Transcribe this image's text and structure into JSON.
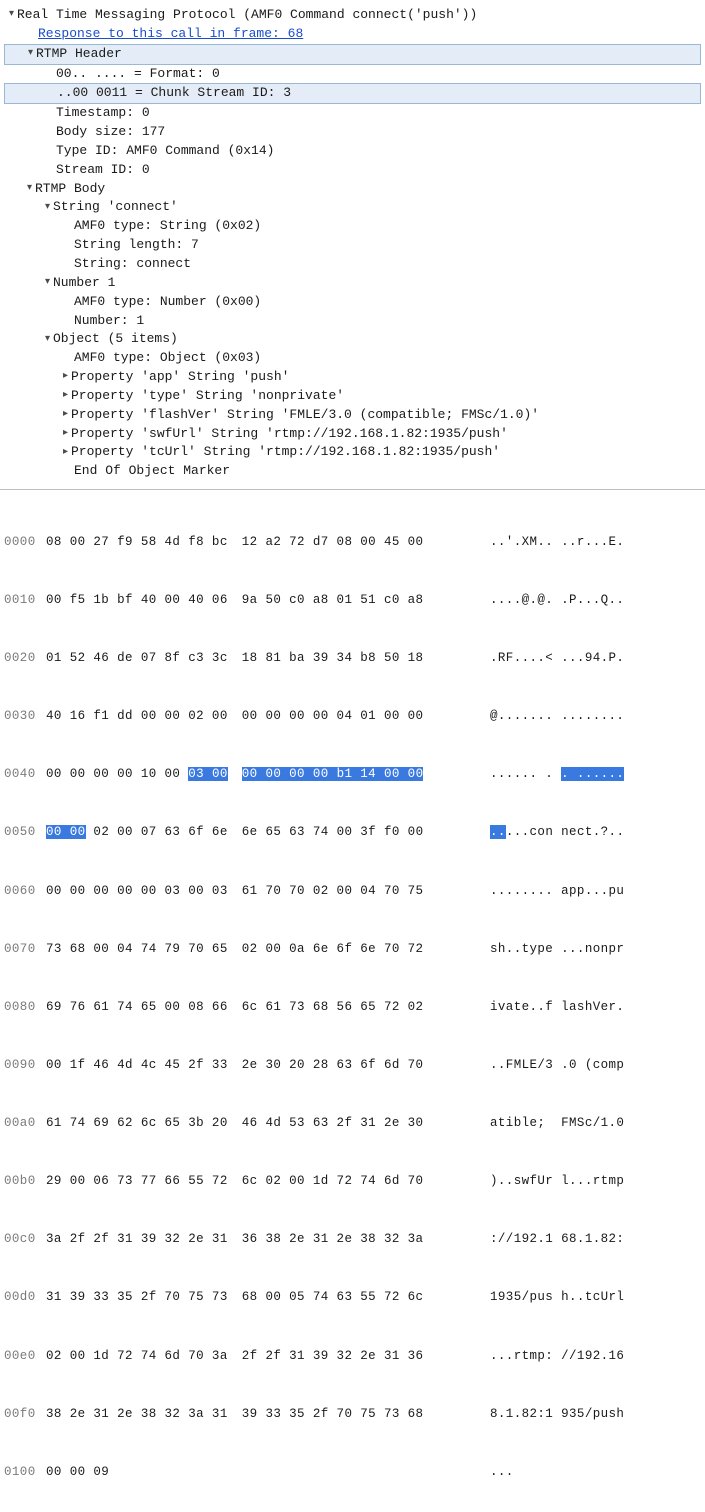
{
  "proto_title": "Real Time Messaging Protocol (AMF0 Command connect('push'))",
  "response_link": "Response to this call in frame: 68",
  "hdr_label": "RTMP Header",
  "hdr_format": "00.. .... = Format: 0",
  "hdr_csid": "..00 0011 = Chunk Stream ID: 3",
  "hdr_ts": "Timestamp: 0",
  "hdr_body": "Body size: 177",
  "hdr_type": "Type ID: AMF0 Command (0x14)",
  "hdr_sid": "Stream ID: 0",
  "body_label": "RTMP Body",
  "str_label": "String 'connect'",
  "str_amf": "AMF0 type: String (0x02)",
  "str_len": "String length: 7",
  "str_val": "String: connect",
  "num_label": "Number 1",
  "num_amf": "AMF0 type: Number (0x00)",
  "num_val": "Number: 1",
  "obj_label": "Object (5 items)",
  "obj_amf": "AMF0 type: Object (0x03)",
  "p_app": "Property 'app' String 'push'",
  "p_type": "Property 'type' String 'nonprivate'",
  "p_flash": "Property 'flashVer' String 'FMLE/3.0 (compatible; FMSc/1.0)'",
  "p_swf": "Property 'swfUrl' String 'rtmp://192.168.1.82:1935/push'",
  "p_tc": "Property 'tcUrl' String 'rtmp://192.168.1.82:1935/push'",
  "obj_end": "End Of Object Marker",
  "hex": {
    "0000": {
      "o": "0000",
      "b1": "08 00 27 f9 58 4d f8 bc",
      "b2": "12 a2 72 d7 08 00 45 00",
      "a1": "..'.XM..",
      "a2": "..r...E."
    },
    "0010": {
      "o": "0010",
      "b1": "00 f5 1b bf 40 00 40 06",
      "b2": "9a 50 c0 a8 01 51 c0 a8",
      "a1": "....@.@.",
      "a2": ".P...Q.."
    },
    "0020": {
      "o": "0020",
      "b1": "01 52 46 de 07 8f c3 3c",
      "b2": "18 81 ba 39 34 b8 50 18",
      "a1": ".RF....<",
      "a2": "...94.P."
    },
    "0030": {
      "o": "0030",
      "b1": "40 16 f1 dd 00 00 02 00",
      "b2": "00 00 00 00 04 01 00 00",
      "a1": "@.......",
      "a2": "........"
    },
    "0040": {
      "o": "0040",
      "b1a": "00 00 00 00 10 00 ",
      "b1sel": "03 00",
      "b2sel": "00 00 00 00 b1 14 00 00",
      "a1a": "...... .",
      "a2sel": ". ......"
    },
    "0050": {
      "o": "0050",
      "b1sel": "00 00",
      "b1b": " 02 00 07 63 6f 6e",
      "b2": "6e 65 63 74 00 3f f0 00",
      "a1sel": "..",
      "a1b": "...con",
      "a2": "nect.?.."
    },
    "0060": {
      "o": "0060",
      "b1": "00 00 00 00 00 03 00 03",
      "b2": "61 70 70 02 00 04 70 75",
      "a1": "........",
      "a2": "app...pu"
    },
    "0070": {
      "o": "0070",
      "b1": "73 68 00 04 74 79 70 65",
      "b2": "02 00 0a 6e 6f 6e 70 72",
      "a1": "sh..type",
      "a2": "...nonpr"
    },
    "0080": {
      "o": "0080",
      "b1": "69 76 61 74 65 00 08 66",
      "b2": "6c 61 73 68 56 65 72 02",
      "a1": "ivate..f",
      "a2": "lashVer."
    },
    "0090": {
      "o": "0090",
      "b1": "00 1f 46 4d 4c 45 2f 33",
      "b2": "2e 30 20 28 63 6f 6d 70",
      "a1": "..FMLE/3",
      "a2": ".0 (comp"
    },
    "00a0": {
      "o": "00a0",
      "b1": "61 74 69 62 6c 65 3b 20",
      "b2": "46 4d 53 63 2f 31 2e 30",
      "a1": "atible; ",
      "a2": "FMSc/1.0"
    },
    "00b0": {
      "o": "00b0",
      "b1": "29 00 06 73 77 66 55 72",
      "b2": "6c 02 00 1d 72 74 6d 70",
      "a1": ")..swfUr",
      "a2": "l...rtmp"
    },
    "00c0": {
      "o": "00c0",
      "b1": "3a 2f 2f 31 39 32 2e 31",
      "b2": "36 38 2e 31 2e 38 32 3a",
      "a1": "://192.1",
      "a2": "68.1.82:"
    },
    "00d0": {
      "o": "00d0",
      "b1": "31 39 33 35 2f 70 75 73",
      "b2": "68 00 05 74 63 55 72 6c",
      "a1": "1935/pus",
      "a2": "h..tcUrl"
    },
    "00e0": {
      "o": "00e0",
      "b1": "02 00 1d 72 74 6d 70 3a",
      "b2": "2f 2f 31 39 32 2e 31 36",
      "a1": "...rtmp:",
      "a2": "//192.16"
    },
    "00f0": {
      "o": "00f0",
      "b1": "38 2e 31 2e 38 32 3a 31",
      "b2": "39 33 35 2f 70 75 73 68",
      "a1": "8.1.82:1",
      "a2": "935/push"
    },
    "0100": {
      "o": "0100",
      "b1": "00 00 09",
      "b2": "",
      "a1": "...",
      "a2": ""
    }
  }
}
